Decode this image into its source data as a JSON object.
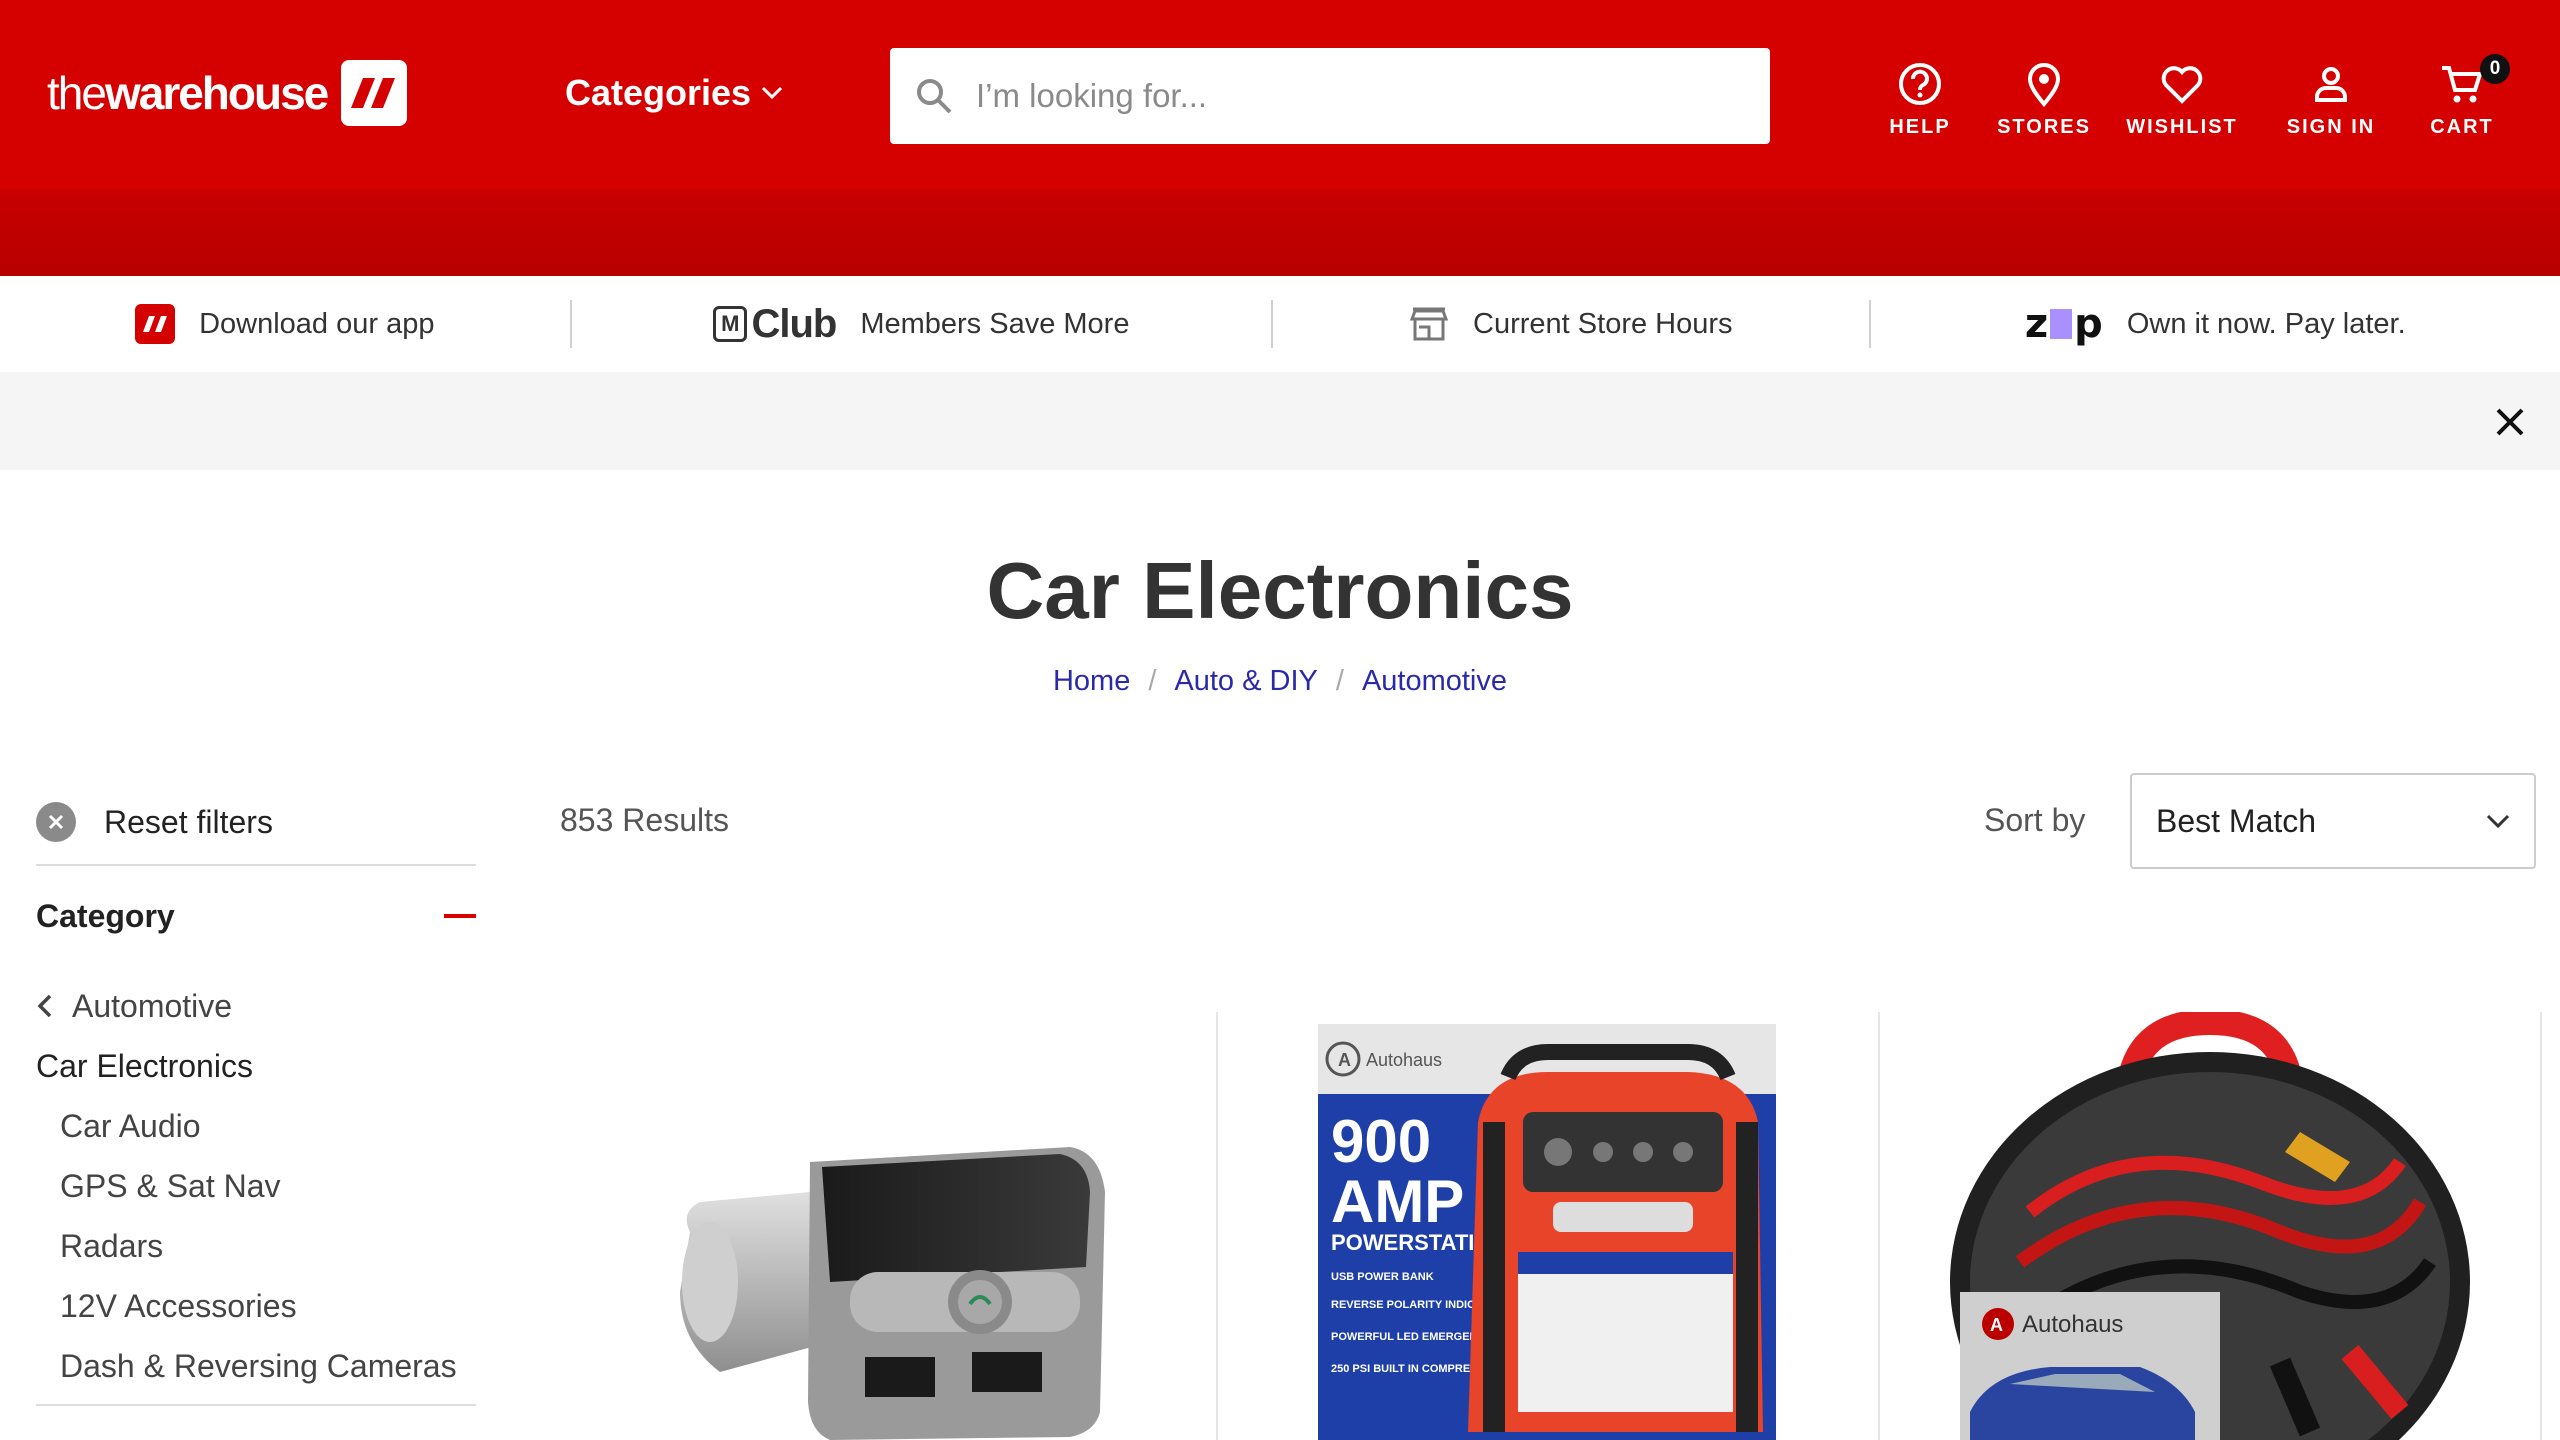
{
  "brand": {
    "name_light": "the",
    "name_bold": "warehouse",
    "color": "#d50000"
  },
  "header": {
    "categories_label": "Categories",
    "search_placeholder": "I’m looking for...",
    "nav": [
      {
        "label": "HELP",
        "icon": "help-icon"
      },
      {
        "label": "STORES",
        "icon": "location-pin-icon"
      },
      {
        "label": "WISHLIST",
        "icon": "heart-icon"
      },
      {
        "label": "SIGN IN",
        "icon": "user-icon"
      },
      {
        "label": "CART",
        "icon": "cart-icon"
      }
    ],
    "cart_count": "0"
  },
  "promos": [
    {
      "label": "Download our app",
      "icon": "warehouse-app-icon"
    },
    {
      "label": "Members Save More",
      "logo_text": "Club",
      "logo_mark": "M"
    },
    {
      "label": "Current Store Hours",
      "icon": "store-icon"
    },
    {
      "label": "Own it now. Pay later.",
      "logo_text": "zip"
    }
  ],
  "page": {
    "title": "Car Electronics",
    "breadcrumb": [
      "Home",
      "Auto & DIY",
      "Automotive"
    ]
  },
  "filters": {
    "reset_label": "Reset filters",
    "category_heading": "Category",
    "parent": "Automotive",
    "current": "Car Electronics",
    "children": [
      "Car Audio",
      "GPS & Sat Nav",
      "Radars",
      "12V Accessories",
      "Dash & Reversing Cameras"
    ]
  },
  "results": {
    "count_label": "853 Results",
    "sort_label": "Sort by",
    "sort_value": "Best Match"
  },
  "products": [
    {
      "image": "bluetooth-fm-transmitter"
    },
    {
      "image": "autohaus-900-amp-powerstation",
      "box_text": {
        "brand": "Autohaus",
        "line1": "900",
        "line2": "AMP",
        "line3": "POWERSTATION",
        "f1": "USB POWER BANK",
        "f2": "REVERSE POLARITY INDICATOR",
        "f3": "POWERFUL LED EMERGENCY WORK LIGHT",
        "f4": "250 PSI BUILT IN COMPRESSOR"
      }
    },
    {
      "image": "autohaus-jumper-leads",
      "bag_text": "Autohaus"
    }
  ]
}
